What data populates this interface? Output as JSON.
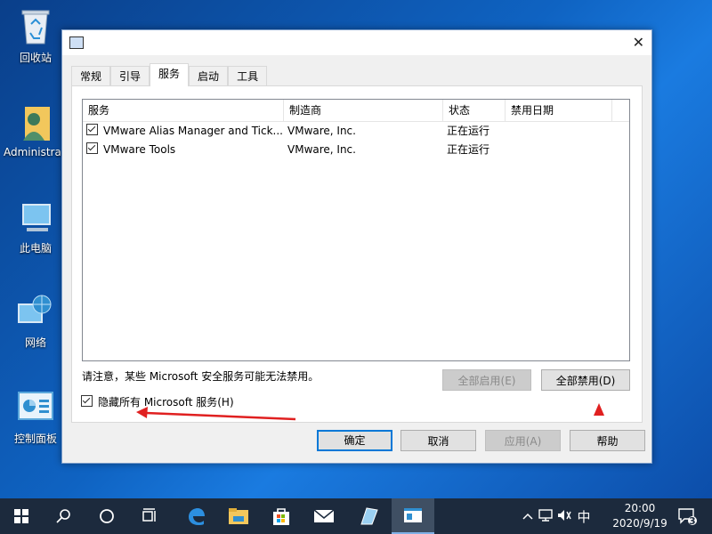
{
  "desktop": {
    "icons": [
      {
        "label": "回收站",
        "icon": "recycle-bin-icon"
      },
      {
        "label": "Administra...",
        "icon": "user-folder-icon"
      },
      {
        "label": "此电脑",
        "icon": "computer-icon"
      },
      {
        "label": "网络",
        "icon": "network-icon"
      },
      {
        "label": "控制面板",
        "icon": "control-panel-icon"
      }
    ]
  },
  "dialog": {
    "close_glyph": "✕",
    "tabs": [
      "常规",
      "引导",
      "服务",
      "启动",
      "工具"
    ],
    "active_tab": "服务",
    "columns": [
      "服务",
      "制造商",
      "状态",
      "禁用日期"
    ],
    "rows": [
      {
        "checked": true,
        "service": "VMware Alias Manager and Tick...",
        "maker": "VMware, Inc.",
        "status": "正在运行",
        "date": ""
      },
      {
        "checked": true,
        "service": "VMware Tools",
        "maker": "VMware, Inc.",
        "status": "正在运行",
        "date": ""
      }
    ],
    "note": "请注意，某些 Microsoft 安全服务可能无法禁用。",
    "enable_all": "全部启用(E)",
    "disable_all": "全部禁用(D)",
    "hide_ms_label": "隐藏所有 Microsoft 服务(H)",
    "hide_ms_checked": true,
    "ok": "确定",
    "cancel": "取消",
    "apply": "应用(A)",
    "help": "帮助"
  },
  "annotation_color": "#e02020",
  "taskbar": {
    "time": "20:00",
    "date": "2020/9/19",
    "ime": "中",
    "notification_count": "3",
    "accent": "#1c2a3d"
  }
}
